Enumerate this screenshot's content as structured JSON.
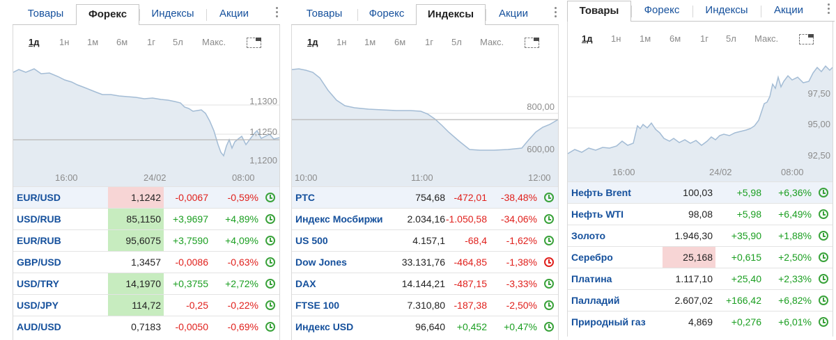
{
  "colors": {
    "link": "#15509c",
    "up": "#1a9e20",
    "down": "#e0201c",
    "price_up_bg": "#c7ecbf",
    "price_down_bg": "#f7d5d5",
    "chart_fill": "#e4ebf2",
    "chart_line": "#a3bcd5"
  },
  "widgets": [
    {
      "tabs": [
        "Товары",
        "Форекс",
        "Индексы",
        "Акции"
      ],
      "active_tab": 1,
      "ranges": [
        "1д",
        "1н",
        "1м",
        "6м",
        "1г",
        "5л",
        "Макс."
      ],
      "active_range": 0,
      "y_labels": [
        "1,1300",
        "1,1250",
        "1,1200"
      ],
      "x_labels": [
        "16:00",
        "24/02",
        "08:00"
      ],
      "rows": [
        {
          "name": "EUR/USD",
          "price": "1,1242",
          "change": "-0,0067",
          "percent": "-0,59%",
          "dir": "down",
          "flash": "down",
          "clock": "green"
        },
        {
          "name": "USD/RUB",
          "price": "85,1150",
          "change": "+3,9697",
          "percent": "+4,89%",
          "dir": "up",
          "flash": "up",
          "clock": "green"
        },
        {
          "name": "EUR/RUB",
          "price": "95,6075",
          "change": "+3,7590",
          "percent": "+4,09%",
          "dir": "up",
          "flash": "up",
          "clock": "green"
        },
        {
          "name": "GBP/USD",
          "price": "1,3457",
          "change": "-0,0086",
          "percent": "-0,63%",
          "dir": "down",
          "flash": "",
          "clock": "green"
        },
        {
          "name": "USD/TRY",
          "price": "14,1970",
          "change": "+0,3755",
          "percent": "+2,72%",
          "dir": "up",
          "flash": "up",
          "clock": "green"
        },
        {
          "name": "USD/JPY",
          "price": "114,72",
          "change": "-0,25",
          "percent": "-0,22%",
          "dir": "down",
          "flash": "up",
          "clock": "green"
        },
        {
          "name": "AUD/USD",
          "price": "0,7183",
          "change": "-0,0050",
          "percent": "-0,69%",
          "dir": "down",
          "flash": "",
          "clock": "green"
        }
      ]
    },
    {
      "tabs": [
        "Товары",
        "Форекс",
        "Индексы",
        "Акции"
      ],
      "active_tab": 2,
      "ranges": [
        "1д",
        "1н",
        "1м",
        "6м",
        "1г",
        "5л",
        "Макс."
      ],
      "active_range": 0,
      "y_labels": [
        "800,00",
        "600,00"
      ],
      "x_labels": [
        "10:00",
        "11:00",
        "12:00"
      ],
      "rows": [
        {
          "name": "PTC",
          "price": "754,68",
          "change": "-472,01",
          "percent": "-38,48%",
          "dir": "down",
          "flash": "",
          "clock": "green"
        },
        {
          "name": "Индекс Мосбиржи",
          "price": "2.034,16",
          "change": "-1.050,58",
          "percent": "-34,06%",
          "dir": "down",
          "flash": "",
          "clock": "green"
        },
        {
          "name": "US 500",
          "price": "4.157,1",
          "change": "-68,4",
          "percent": "-1,62%",
          "dir": "down",
          "flash": "",
          "clock": "green"
        },
        {
          "name": "Dow Jones",
          "price": "33.131,76",
          "change": "-464,85",
          "percent": "-1,38%",
          "dir": "down",
          "flash": "",
          "clock": "red"
        },
        {
          "name": "DAX",
          "price": "14.144,21",
          "change": "-487,15",
          "percent": "-3,33%",
          "dir": "down",
          "flash": "",
          "clock": "green"
        },
        {
          "name": "FTSE 100",
          "price": "7.310,80",
          "change": "-187,38",
          "percent": "-2,50%",
          "dir": "down",
          "flash": "",
          "clock": "green"
        },
        {
          "name": "Индекс USD",
          "price": "96,640",
          "change": "+0,452",
          "percent": "+0,47%",
          "dir": "up",
          "flash": "",
          "clock": "green"
        }
      ]
    },
    {
      "tabs": [
        "Товары",
        "Форекс",
        "Индексы",
        "Акции"
      ],
      "active_tab": 0,
      "ranges": [
        "1д",
        "1н",
        "1м",
        "6м",
        "1г",
        "5л",
        "Макс."
      ],
      "active_range": 0,
      "y_labels": [
        "97,50",
        "95,00",
        "92,50"
      ],
      "x_labels": [
        "16:00",
        "24/02",
        "08:00"
      ],
      "rows": [
        {
          "name": "Нефть Brent",
          "price": "100,03",
          "change": "+5,98",
          "percent": "+6,36%",
          "dir": "up",
          "flash": "",
          "clock": "green"
        },
        {
          "name": "Нефть WTI",
          "price": "98,08",
          "change": "+5,98",
          "percent": "+6,49%",
          "dir": "up",
          "flash": "",
          "clock": "green"
        },
        {
          "name": "Золото",
          "price": "1.946,30",
          "change": "+35,90",
          "percent": "+1,88%",
          "dir": "up",
          "flash": "",
          "clock": "green"
        },
        {
          "name": "Серебро",
          "price": "25,168",
          "change": "+0,615",
          "percent": "+2,50%",
          "dir": "up",
          "flash": "down",
          "clock": "green"
        },
        {
          "name": "Платина",
          "price": "1.117,10",
          "change": "+25,40",
          "percent": "+2,33%",
          "dir": "up",
          "flash": "",
          "clock": "green"
        },
        {
          "name": "Палладий",
          "price": "2.607,02",
          "change": "+166,42",
          "percent": "+6,82%",
          "dir": "up",
          "flash": "",
          "clock": "green"
        },
        {
          "name": "Природный газ",
          "price": "4,869",
          "change": "+0,276",
          "percent": "+6,01%",
          "dir": "up",
          "flash": "",
          "clock": "green"
        }
      ]
    }
  ]
}
